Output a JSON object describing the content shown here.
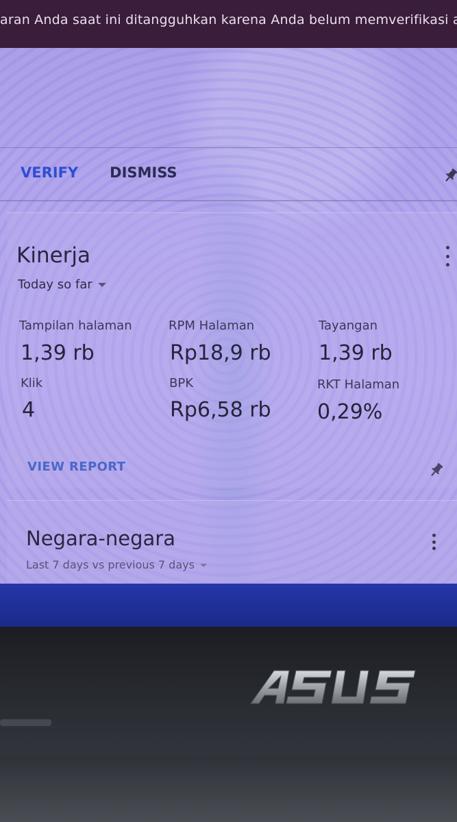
{
  "notification": {
    "text": "aran Anda saat ini ditangguhkan karena Anda belum memverifikasi alama"
  },
  "alert": {
    "verify_label": "VERIFY",
    "dismiss_label": "DISMISS",
    "pin_icon": "pin-icon"
  },
  "performance_card": {
    "title": "Kinerja",
    "range": "Today so far",
    "metrics": [
      {
        "label": "Tampilan halaman",
        "value": "1,39 rb"
      },
      {
        "label": "RPM Halaman",
        "value": "Rp18,9 rb"
      },
      {
        "label": "Tayangan",
        "value": "1,39 rb"
      },
      {
        "label": "Klik",
        "value": "4"
      },
      {
        "label": "BPK",
        "value": "Rp6,58 rb"
      },
      {
        "label": "RKT Halaman",
        "value": "0,29%"
      }
    ],
    "view_report_label": "VIEW REPORT",
    "menu_icon": "more-vert-icon",
    "pin_icon": "pin-icon"
  },
  "countries_card": {
    "title": "Negara-negara",
    "range": "Last 7 days vs previous 7 days",
    "menu_icon": "more-vert-icon"
  },
  "laptop": {
    "brand": "ASUS"
  },
  "colors": {
    "screen_bg": "#b1a6ec",
    "accent_blue": "#2f4fd0",
    "notif_bg": "#3a1d3a",
    "bottom_bar": "#1a2a8a",
    "bezel": "#1b1d22"
  }
}
